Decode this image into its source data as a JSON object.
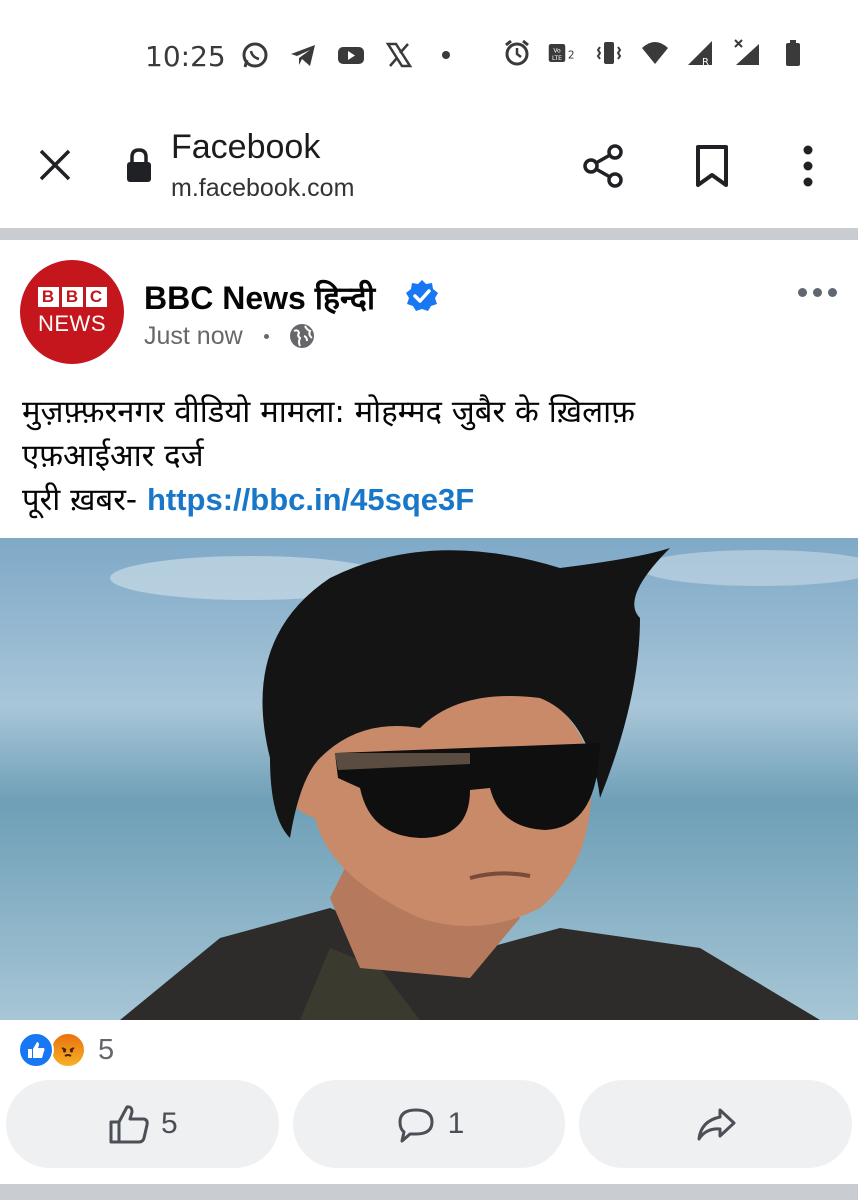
{
  "status_bar": {
    "time": "10:25",
    "icons_left": [
      "whatsapp-icon",
      "telegram-icon",
      "youtube-icon",
      "x-icon"
    ],
    "icons_right": [
      "alarm-icon",
      "volte-icon",
      "vibrate-icon",
      "wifi-icon",
      "signal-r-icon",
      "signal-x-icon",
      "battery-icon"
    ],
    "volte_label": "Vo\nLTE2"
  },
  "browser": {
    "title": "Facebook",
    "url": "m.facebook.com"
  },
  "post": {
    "page_name": "BBC News हिन्दी",
    "time": "Just now",
    "avatar_letters": [
      "B",
      "B",
      "C"
    ],
    "avatar_news": "NEWS",
    "text_line1": "मुज़फ़्फ़रनगर वीडियो मामला: मोहम्मद जुबैर के ख़िलाफ़",
    "text_line2": "एफ़आईआर दर्ज",
    "text_line3_prefix": "पूरी ख़बर- ",
    "link": "https://bbc.in/45sqe3F",
    "reaction_count": "5",
    "like_count": "5",
    "comment_count": "1"
  },
  "colors": {
    "bbc_red": "#c4161c",
    "link_blue": "#1877c9",
    "verified_blue": "#1877f2",
    "divider_gray": "#c9ccd1"
  }
}
